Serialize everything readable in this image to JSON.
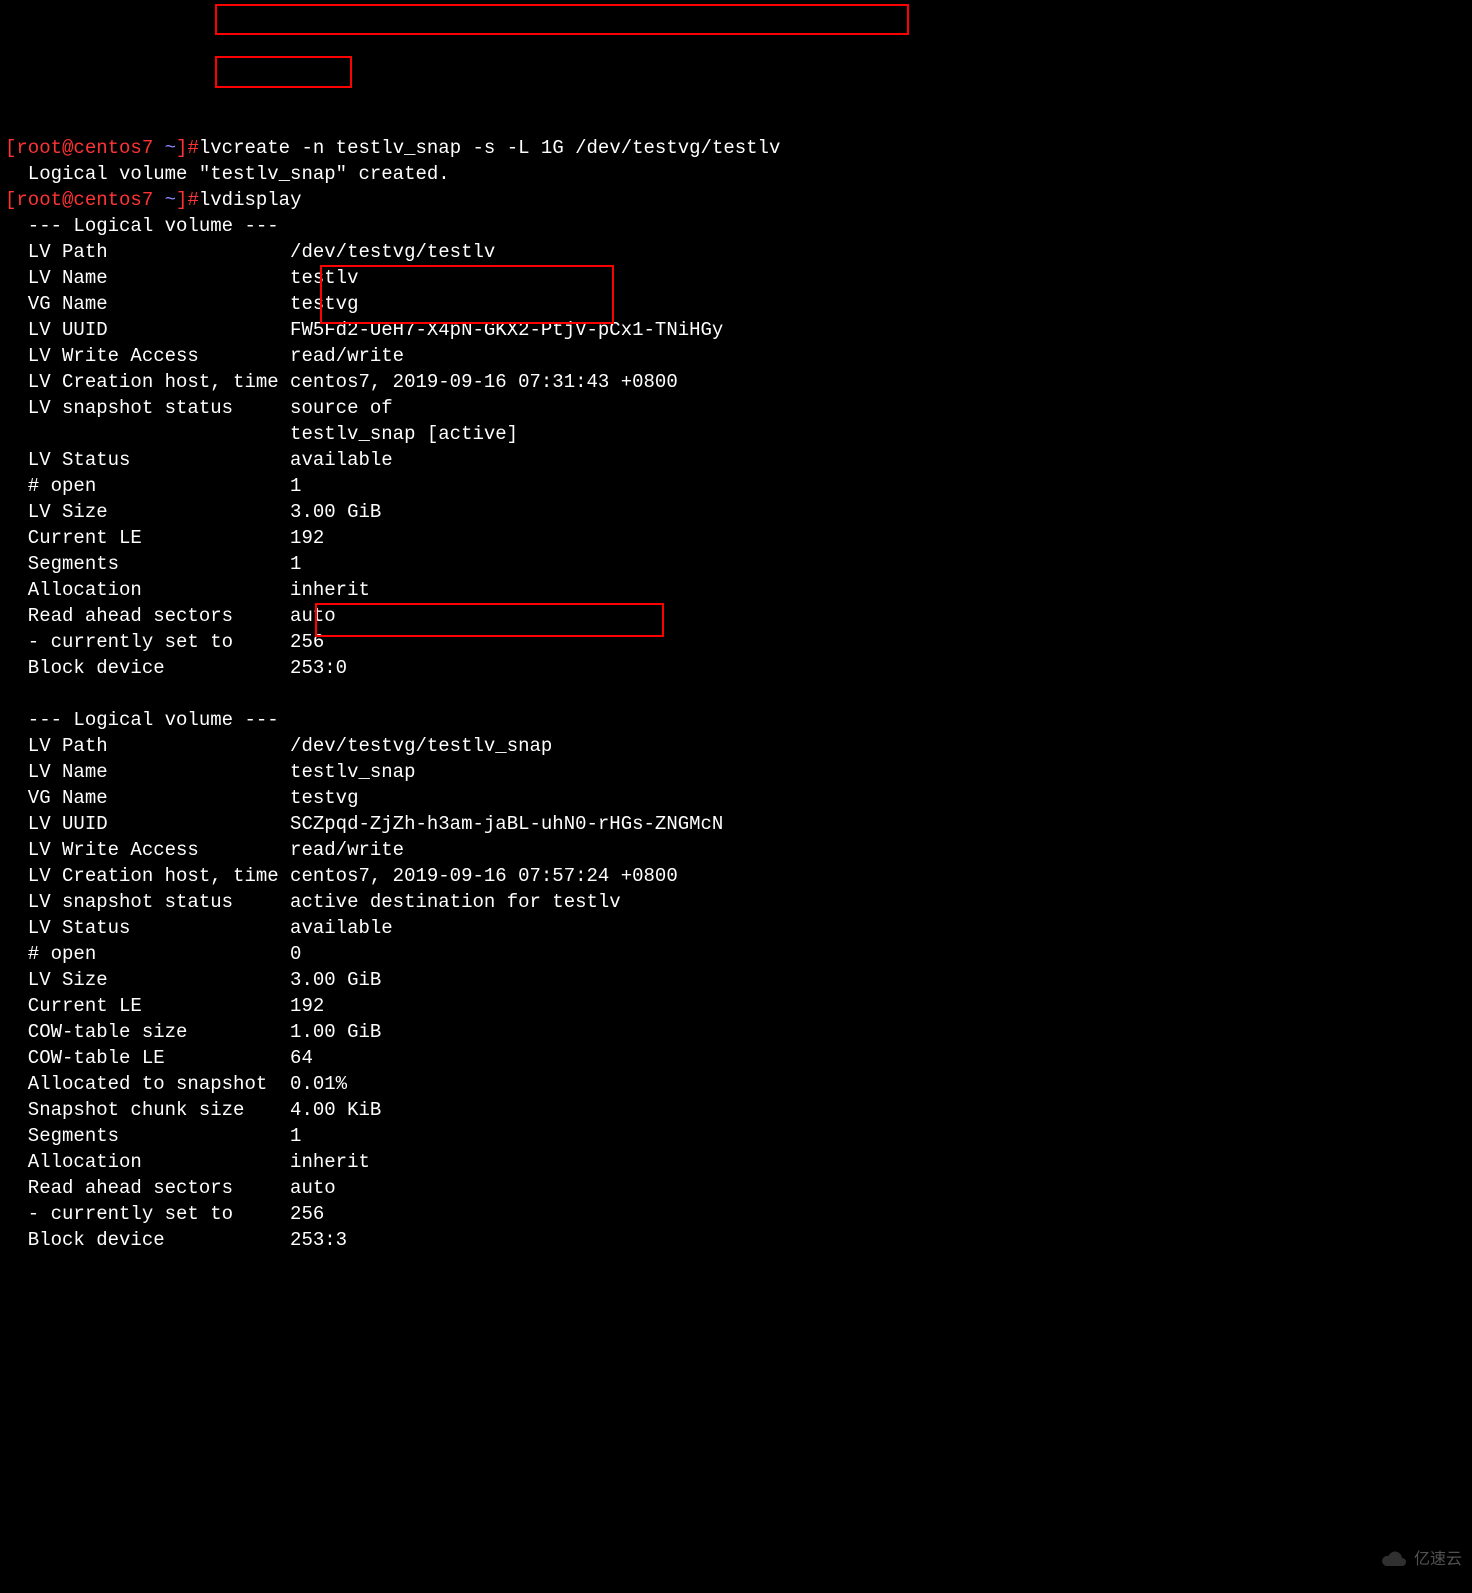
{
  "prompt1": {
    "user": "[root@centos7 ",
    "tilde": "~",
    "end": "]#",
    "cmd": "lvcreate -n testlv_snap -s -L 1G /dev/testvg/testlv"
  },
  "created_msg": "  Logical volume \"testlv_snap\" created.",
  "prompt2": {
    "user": "[root@centos7 ",
    "tilde": "~",
    "end": "]#",
    "cmd": "lvdisplay"
  },
  "lv1": {
    "header": "  --- Logical volume ---",
    "path_k": "  LV Path               ",
    "path_v": " /dev/testvg/testlv",
    "name_k": "  LV Name               ",
    "name_v": " testlv",
    "vg_k": "  VG Name               ",
    "vg_v": " testvg",
    "uuid_k": "  LV UUID               ",
    "uuid_v": " FW5Fd2-UeH7-X4pN-GKX2-PtjV-pCx1-TNiHGy",
    "wa_k": "  LV Write Access       ",
    "wa_v": " read/write",
    "ct_k": "  LV Creation host, time",
    "ct_v": " centos7, 2019-09-16 07:31:43 +0800",
    "ss_k": "  LV snapshot status    ",
    "ss_v": " source of",
    "ss2": "                         testlv_snap [active]",
    "st_k": "  LV Status             ",
    "st_v": " available",
    "op_k": "  # open                ",
    "op_v": " 1",
    "sz_k": "  LV Size               ",
    "sz_v": " 3.00 GiB",
    "le_k": "  Current LE            ",
    "le_v": " 192",
    "sg_k": "  Segments              ",
    "sg_v": " 1",
    "al_k": "  Allocation            ",
    "al_v": " inherit",
    "ra_k": "  Read ahead sectors    ",
    "ra_v": " auto",
    "cs_k": "  - currently set to    ",
    "cs_v": " 256",
    "bd_k": "  Block device          ",
    "bd_v": " 253:0"
  },
  "blank": " ",
  "lv2": {
    "header": "  --- Logical volume ---",
    "path_k": "  LV Path               ",
    "path_v": " /dev/testvg/testlv_snap",
    "name_k": "  LV Name               ",
    "name_v": " testlv_snap",
    "vg_k": "  VG Name               ",
    "vg_v": " testvg",
    "uuid_k": "  LV UUID               ",
    "uuid_v": " SCZpqd-ZjZh-h3am-jaBL-uhN0-rHGs-ZNGMcN",
    "wa_k": "  LV Write Access       ",
    "wa_v": " read/write",
    "ct_k": "  LV Creation host, time",
    "ct_v": " centos7, 2019-09-16 07:57:24 +0800",
    "ss_k": "  LV snapshot status    ",
    "ss_v": " active destination for testlv",
    "st_k": "  LV Status             ",
    "st_v": " available",
    "op_k": "  # open                ",
    "op_v": " 0",
    "sz_k": "  LV Size               ",
    "sz_v": " 3.00 GiB",
    "le_k": "  Current LE            ",
    "le_v": " 192",
    "cw_k": "  COW-table size        ",
    "cw_v": " 1.00 GiB",
    "cl_k": "  COW-table LE          ",
    "cl_v": " 64",
    "as_k": "  Allocated to snapshot ",
    "as_v": " 0.01%",
    "sc_k": "  Snapshot chunk size   ",
    "sc_v": " 4.00 KiB",
    "sg_k": "  Segments              ",
    "sg_v": " 1",
    "al_k": "  Allocation            ",
    "al_v": " inherit",
    "ra_k": "  Read ahead sectors    ",
    "ra_v": " auto",
    "cs_k": "  - currently set to    ",
    "cs_v": " 256",
    "bd_k": "  Block device          ",
    "bd_v": " 253:3"
  },
  "watermark": "亿速云"
}
